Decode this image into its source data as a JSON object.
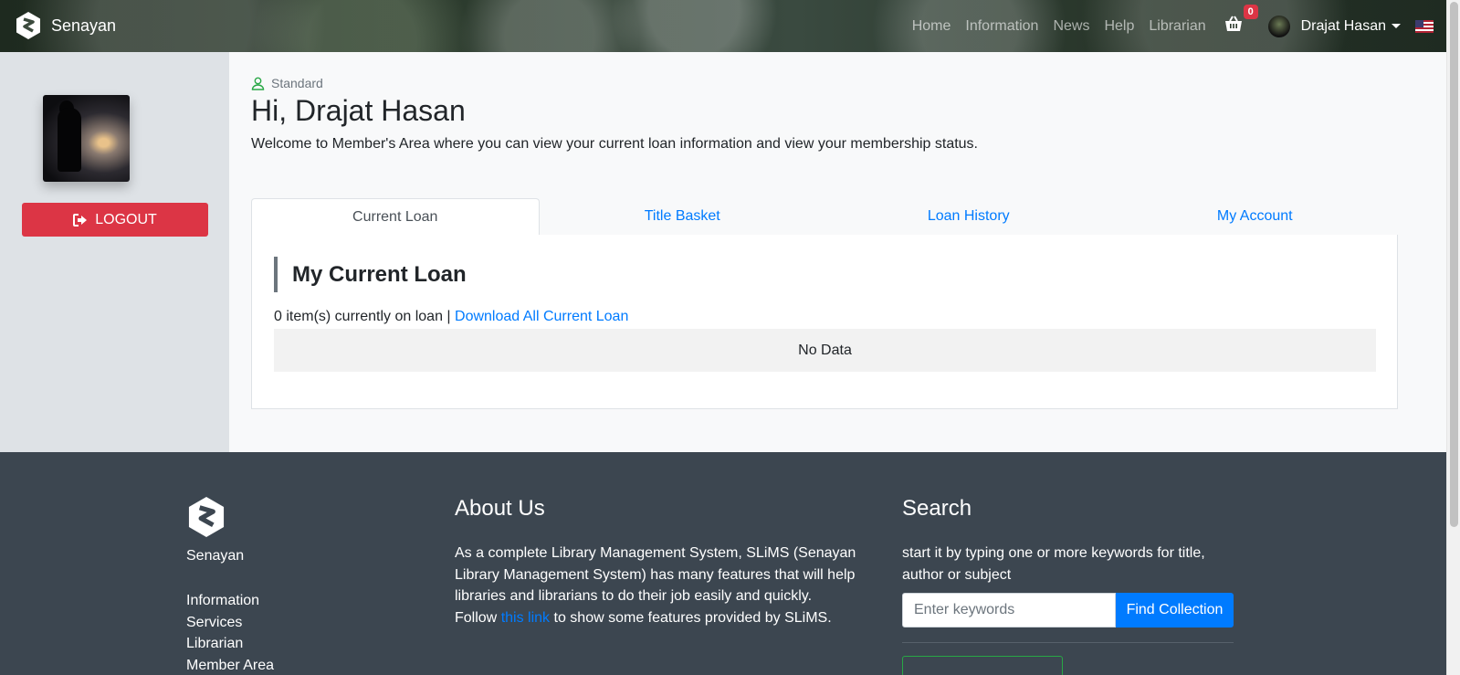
{
  "navbar": {
    "brand": "Senayan",
    "links": [
      "Home",
      "Information",
      "News",
      "Help",
      "Librarian"
    ],
    "basket_count": "0",
    "user_name": "Drajat Hasan",
    "language_icon": "us-flag-icon"
  },
  "sidebar": {
    "logout_label": "LOGOUT"
  },
  "main": {
    "member_type": "Standard",
    "greeting": "Hi, Drajat Hasan",
    "welcome": "Welcome to Member's Area where you can view your current loan information and view your membership status.",
    "tabs": [
      {
        "label": "Current Loan",
        "active": true
      },
      {
        "label": "Title Basket",
        "active": false
      },
      {
        "label": "Loan History",
        "active": false
      },
      {
        "label": "My Account",
        "active": false
      }
    ],
    "section_title": "My Current Loan",
    "loan_count_text": "0 item(s) currently on loan |",
    "download_link": "Download All Current Loan",
    "no_data": "No Data"
  },
  "footer": {
    "brand": "Senayan",
    "links": [
      "Information",
      "Services",
      "Librarian",
      "Member Area"
    ],
    "about": {
      "title": "About Us",
      "text_before": "As a complete Library Management System, SLiMS (Senayan Library Management System) has many features that will help libraries and librarians to do their job easily and quickly. Follow",
      "link": "this link",
      "text_after": "to show some features provided by SLiMS."
    },
    "search": {
      "title": "Search",
      "text": "start it by typing one or more keywords for title, author or subject",
      "placeholder": "Enter keywords",
      "button": "Find Collection"
    }
  },
  "colors": {
    "primary": "#007bff",
    "danger": "#dc3545",
    "footer_bg": "#3c4650",
    "sidebar_bg": "#dee2e6"
  }
}
